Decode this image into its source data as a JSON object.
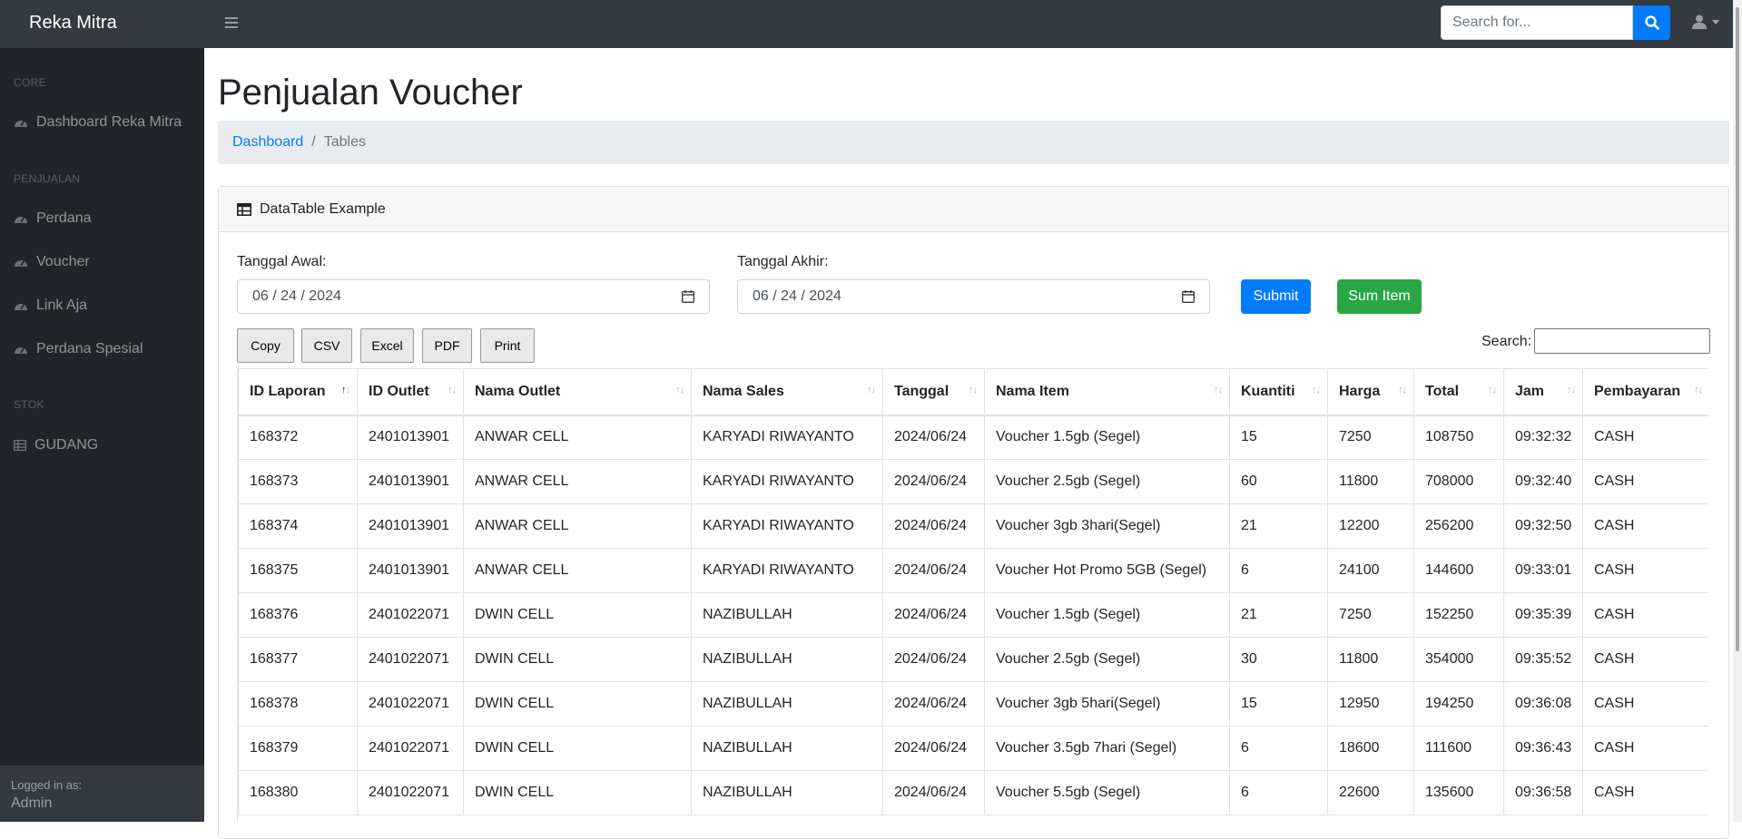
{
  "app": {
    "brand": "Reka Mitra"
  },
  "topbar": {
    "search_placeholder": "Search for..."
  },
  "sidebar": {
    "sections": [
      {
        "heading": "Core",
        "items": [
          {
            "label": "Dashboard Reka Mitra",
            "icon": "tachometer-icon"
          }
        ]
      },
      {
        "heading": "Penjualan",
        "items": [
          {
            "label": "Perdana",
            "icon": "tachometer-icon"
          },
          {
            "label": "Voucher",
            "icon": "tachometer-icon"
          },
          {
            "label": "Link Aja",
            "icon": "tachometer-icon"
          },
          {
            "label": "Perdana Spesial",
            "icon": "tachometer-icon"
          }
        ]
      },
      {
        "heading": "Stok",
        "items": [
          {
            "label": "GUDANG",
            "icon": "table-icon"
          }
        ]
      }
    ],
    "footer": {
      "logged_in_label": "Logged in as:",
      "user": "Admin"
    }
  },
  "page": {
    "title": "Penjualan Voucher",
    "breadcrumb": {
      "link": "Dashboard",
      "separator": "/",
      "active": "Tables"
    }
  },
  "card": {
    "title": "DataTable Example",
    "filters": {
      "start_label": "Tanggal Awal:",
      "start_value": "06 / 24 / 2024",
      "end_label": "Tanggal Akhir:",
      "end_value": "06 / 24 / 2024",
      "submit_label": "Submit",
      "sum_label": "Sum Item"
    },
    "export_buttons": [
      "Copy",
      "CSV",
      "Excel",
      "PDF",
      "Print"
    ],
    "search_label": "Search:",
    "table": {
      "columns": [
        "ID Laporan",
        "ID Outlet",
        "Nama Outlet",
        "Nama Sales",
        "Tanggal",
        "Nama Item",
        "Kuantiti",
        "Harga",
        "Total",
        "Jam",
        "Pembayaran"
      ],
      "rows": [
        [
          "168372",
          "2401013901",
          "ANWAR CELL",
          "KARYADI RIWAYANTO",
          "2024/06/24",
          "Voucher 1.5gb (Segel)",
          "15",
          "7250",
          "108750",
          "09:32:32",
          "CASH"
        ],
        [
          "168373",
          "2401013901",
          "ANWAR CELL",
          "KARYADI RIWAYANTO",
          "2024/06/24",
          "Voucher 2.5gb (Segel)",
          "60",
          "11800",
          "708000",
          "09:32:40",
          "CASH"
        ],
        [
          "168374",
          "2401013901",
          "ANWAR CELL",
          "KARYADI RIWAYANTO",
          "2024/06/24",
          "Voucher 3gb 3hari(Segel)",
          "21",
          "12200",
          "256200",
          "09:32:50",
          "CASH"
        ],
        [
          "168375",
          "2401013901",
          "ANWAR CELL",
          "KARYADI RIWAYANTO",
          "2024/06/24",
          "Voucher Hot Promo 5GB (Segel)",
          "6",
          "24100",
          "144600",
          "09:33:01",
          "CASH"
        ],
        [
          "168376",
          "2401022071",
          "DWIN CELL",
          "NAZIBULLAH",
          "2024/06/24",
          "Voucher 1.5gb (Segel)",
          "21",
          "7250",
          "152250",
          "09:35:39",
          "CASH"
        ],
        [
          "168377",
          "2401022071",
          "DWIN CELL",
          "NAZIBULLAH",
          "2024/06/24",
          "Voucher 2.5gb (Segel)",
          "30",
          "11800",
          "354000",
          "09:35:52",
          "CASH"
        ],
        [
          "168378",
          "2401022071",
          "DWIN CELL",
          "NAZIBULLAH",
          "2024/06/24",
          "Voucher 3gb 5hari(Segel)",
          "15",
          "12950",
          "194250",
          "09:36:08",
          "CASH"
        ],
        [
          "168379",
          "2401022071",
          "DWIN CELL",
          "NAZIBULLAH",
          "2024/06/24",
          "Voucher 3.5gb 7hari (Segel)",
          "6",
          "18600",
          "111600",
          "09:36:43",
          "CASH"
        ],
        [
          "168380",
          "2401022071",
          "DWIN CELL",
          "NAZIBULLAH",
          "2024/06/24",
          "Voucher 5.5gb (Segel)",
          "6",
          "22600",
          "135600",
          "09:36:58",
          "CASH"
        ]
      ]
    }
  }
}
